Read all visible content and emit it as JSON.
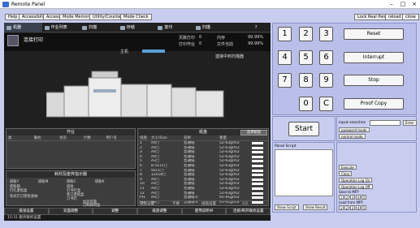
{
  "window": {
    "title": "Remote Panel"
  },
  "toolbar": {
    "buttons": [
      "Help",
      "Accessibility",
      "Access",
      "Mode Memory",
      "Utility/Counter",
      "Mode Check"
    ],
    "right_buttons": [
      "Lock Real Panel",
      "reload",
      "close"
    ]
  },
  "screen": {
    "tabs": [
      "机器",
      "作业列表",
      "扫描",
      "存储",
      "复印",
      "扫描",
      "",
      "?"
    ],
    "title": "连接打印",
    "host_label": "主机",
    "status": [
      {
        "label": "页数打印",
        "val1": "0",
        "val2": "0",
        "unit": "页"
      },
      {
        "label": "打印作业",
        "val1": "0",
        "val2": "0",
        "unit": "作业"
      }
    ],
    "right_counts": [
      {
        "label": "内存",
        "value": "99.99%"
      },
      {
        "label": "文件当前",
        "value": "99.99%"
      }
    ],
    "scanner_label": "連接中到扫描器",
    "job_panel": {
      "title": "作业",
      "headers": [
        "类",
        "餐式",
        "状态",
        "计数",
        "用户名"
      ]
    },
    "consumables": {
      "title": "耗材及废弃指示器",
      "items": [
        "碳粉Y",
        "碳粉M",
        "碳粉C",
        "碳粉K",
        "废粉箱",
        "纸张",
        "钉书钉盒",
        "打孔废纸盒",
        "装订废纸盒",
        "软式钉订废纸收纳",
        "订书钉",
        "加装装置",
        "订购耗材盒"
      ]
    },
    "paper_panel": {
      "title": "纸盘",
      "button": "选择纸盘",
      "headers": [
        "纸盘",
        "大小/Size",
        "名称",
        "重量"
      ],
      "rows": [
        [
          "1",
          "A4▢",
          "普通纸",
          "52-63g/m2"
        ],
        [
          "2",
          "A4▢",
          "普通纸",
          "52-63g/m2"
        ],
        [
          "3",
          "A4▢",
          "普通纸",
          "52-63g/m2"
        ],
        [
          "4",
          "A4▢",
          "普通纸",
          "52-63g/m2"
        ],
        [
          "5",
          "A3▢",
          "普通纸",
          "52-63g/m2"
        ],
        [
          "6",
          "8.5x11▢",
          "普通纸",
          "52-63g/m2"
        ],
        [
          "7",
          "9x11▢",
          "普通纸",
          "52-63g/m2"
        ],
        [
          "8",
          "12x18▢",
          "普通纸",
          "52-63g/m2"
        ],
        [
          "9",
          "A4▢",
          "普通纸",
          "52-63g/m2"
        ],
        [
          "10",
          "A4▢",
          "普通纸",
          "52-63g/m2"
        ],
        [
          "11",
          "A4▢",
          "普通纸",
          "52-63g/m2"
        ],
        [
          "12",
          "A4▢",
          "普通纸",
          "52-63g/m2"
        ],
        [
          "PI1",
          "A4▢",
          "普通纸-k",
          "91-91g/m2"
        ],
        [
          "PI2",
          "A4▢",
          "普通纸-k",
          "91-91g/m2"
        ]
      ],
      "footer": [
        "纸盘设置",
        "不要",
        "纸盘设置",
        "1/2"
      ]
    },
    "bottom_tabs": [
      "纸张设置",
      "双面调整",
      "调整",
      "纸盘调整",
      "使用说明书",
      "连接/断开联机设置"
    ],
    "footer_text": "15:31  服务联机设置"
  },
  "keypad": {
    "keys": [
      "1",
      "2",
      "3",
      "4",
      "5",
      "6",
      "7",
      "8",
      "9",
      "0",
      "C"
    ],
    "functions": [
      "Reset",
      "Interrupt",
      "Stop",
      "Proof Copy"
    ],
    "start": "Start"
  },
  "side": {
    "input_label": "input searches",
    "enter": "Enter",
    "password_mode": "password mode",
    "normal_mode": "normal mode"
  },
  "script": {
    "title": "Panel Script",
    "show_script": "Show Script",
    "show_result": "Show Result"
  },
  "controls": {
    "execute": "Execute",
    "clear": "Clear",
    "op_on": "Operation Log On",
    "op_off": "Operation Log Off",
    "save_label": "Save to MFP",
    "load_label": "Load from MFP",
    "save_slots": [
      "1",
      "2",
      "3",
      "4",
      "5"
    ],
    "load_slots": [
      "1",
      "2",
      "3",
      "4",
      "5"
    ]
  }
}
